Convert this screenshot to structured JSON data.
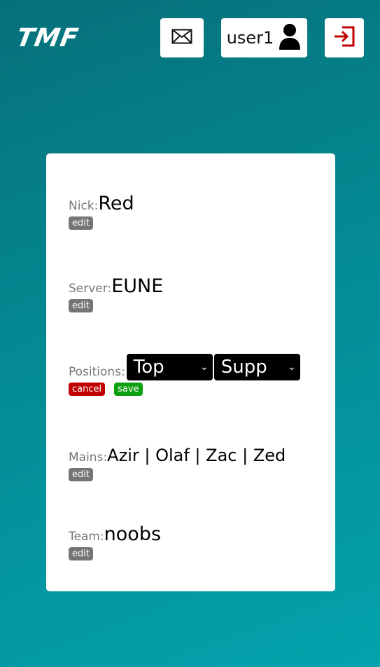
{
  "header": {
    "logo": "TMF",
    "user_name": "user1"
  },
  "icons": {
    "mail": "envelope-icon",
    "user": "user-icon",
    "logout": "sign-in-icon"
  },
  "colors": {
    "logout_icon": "#c00000",
    "edit_tag": "#757575",
    "cancel_tag": "#c00000",
    "save_tag": "#0ca010"
  },
  "profile": {
    "nick": {
      "label": "Nick:",
      "value": "Red",
      "edit_label": "edit"
    },
    "server": {
      "label": "Server:",
      "value": "EUNE",
      "edit_label": "edit"
    },
    "positions": {
      "label": "Positions:",
      "primary": "Top",
      "secondary": "Supp",
      "cancel_label": "cancel",
      "save_label": "save"
    },
    "mains": {
      "label": "Mains:",
      "value": "Azir | Olaf | Zac | Zed",
      "edit_label": "edit"
    },
    "team": {
      "label": "Team:",
      "value": "noobs",
      "edit_label": "edit"
    }
  }
}
